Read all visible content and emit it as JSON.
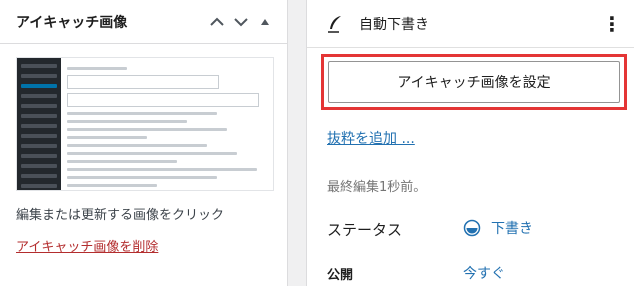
{
  "left_panel": {
    "title": "アイキャッチ画像",
    "description": "編集または更新する画像をクリック",
    "remove_link": "アイキャッチ画像を削除"
  },
  "right_panel": {
    "draft_title": "自動下書き",
    "set_featured_button": "アイキャッチ画像を設定",
    "add_excerpt_link": "抜粋を追加 ...",
    "last_edited": "最終編集1秒前。",
    "status_label": "ステータス",
    "status_value": "下書き",
    "publish_label": "公開",
    "publish_value": "今すぐ"
  },
  "colors": {
    "link_blue": "#2271b1",
    "remove_red": "#b32d2e",
    "highlight_red": "#e43535"
  },
  "icons": [
    "chevron-up-icon",
    "chevron-down-icon",
    "caret-up-icon",
    "quill-icon",
    "kebab-menu-icon",
    "draft-status-icon"
  ]
}
